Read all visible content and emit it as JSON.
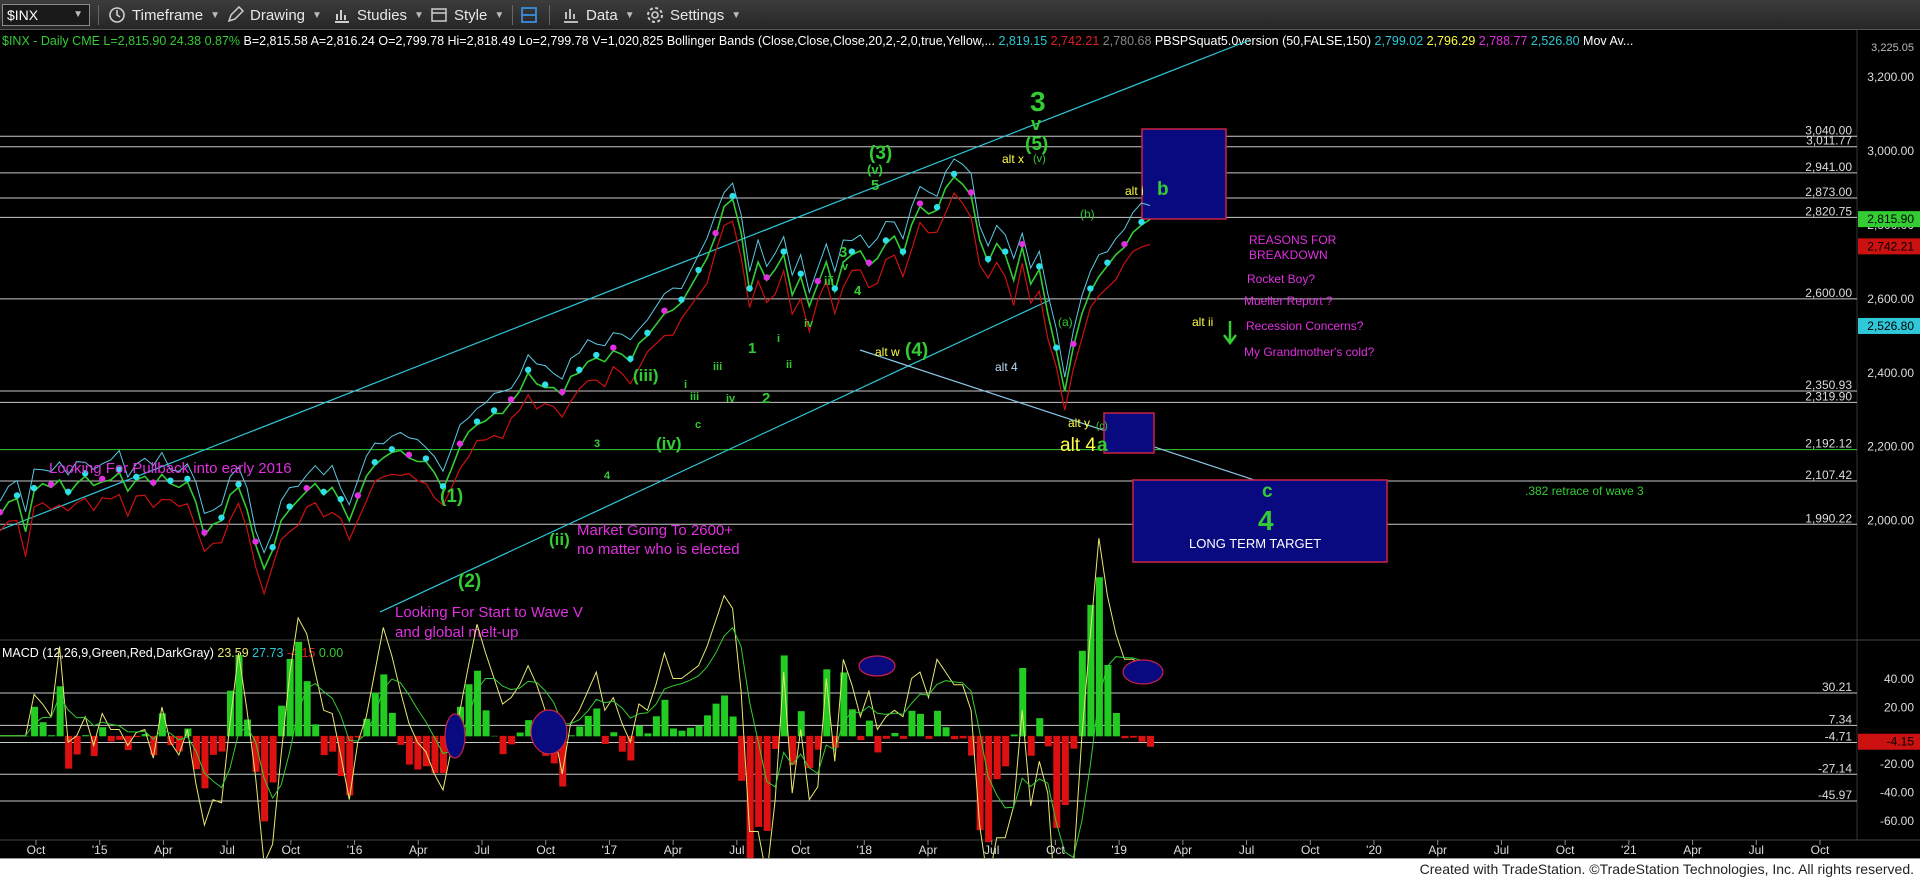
{
  "toolbar": {
    "symbol": "$INX",
    "timeframe": "Timeframe",
    "drawing": "Drawing",
    "studies": "Studies",
    "style": "Style",
    "data": "Data",
    "settings": "Settings"
  },
  "colors": {
    "bg": "#000000",
    "bright_green": "#33cc33",
    "magenta": "#e030e0",
    "yellow": "#ffff44",
    "cyan": "#2ec8d8",
    "light_blue": "#b8d8f0",
    "red": "#cc1111",
    "box_fill": "#0a0a80",
    "box_border": "#cc2244"
  },
  "header_line": [
    {
      "text": "$INX - Daily",
      "color": "#33cc33"
    },
    {
      "text": "CME",
      "color": "#33cc33"
    },
    {
      "text": "L=2,815.90",
      "color": "#33cc33"
    },
    {
      "text": "24.38",
      "color": "#33cc33"
    },
    {
      "text": "0.87%",
      "color": "#33cc33"
    },
    {
      "text": "B=2,815.58",
      "color": "#ffffff"
    },
    {
      "text": "A=2,816.24",
      "color": "#ffffff"
    },
    {
      "text": "O=2,799.78",
      "color": "#ffffff"
    },
    {
      "text": "Hi=2,818.49",
      "color": "#ffffff"
    },
    {
      "text": "Lo=2,799.78",
      "color": "#ffffff"
    },
    {
      "text": "V=1,020,825",
      "color": "#ffffff"
    },
    {
      "text": "Bollinger Bands (Close,Close,Close,20,2,-2,0,true,Yellow,...",
      "color": "#ffffff"
    },
    {
      "text": "2,819.15",
      "color": "#2ec8d8"
    },
    {
      "text": "2,742.21",
      "color": "#dd2222"
    },
    {
      "text": "2,780.68",
      "color": "#888888"
    },
    {
      "text": "PBSPSquat5.0version (50,FALSE,150)",
      "color": "#ffffff"
    },
    {
      "text": "2,799.02",
      "color": "#2ec8d8"
    },
    {
      "text": "2,796.29",
      "color": "#ffff44"
    },
    {
      "text": "2,788.77",
      "color": "#e030e0"
    },
    {
      "text": "2,526.80",
      "color": "#2ec8d8"
    },
    {
      "text": "Mov Av...",
      "color": "#ffffff"
    }
  ],
  "chart_data": [
    {
      "type": "line",
      "title": "$INX - Daily",
      "yscale": "linear",
      "ylim": [
        1880,
        3260
      ],
      "x_tick_labels": [
        "Oct",
        "'15",
        "Apr",
        "Jul",
        "Oct",
        "'16",
        "Apr",
        "Jul",
        "Oct",
        "'17",
        "Apr",
        "Jul",
        "Oct",
        "'18",
        "Apr",
        "Jul",
        "Oct",
        "'19",
        "Apr",
        "Jul",
        "Oct",
        "'20",
        "Apr",
        "Jul",
        "Oct",
        "'21",
        "Apr",
        "Jul",
        "Oct"
      ],
      "y_tick_labels": [
        2000,
        2200,
        2400,
        2600,
        2800,
        3000,
        3200
      ],
      "top_partial_label": "3,225.05",
      "horizontal_levels": [
        {
          "label": "3,040.00",
          "value": 3040
        },
        {
          "label": "3,011.77",
          "value": 3011.77
        },
        {
          "label": "2,941.00",
          "value": 2941
        },
        {
          "label": "2,873.00",
          "value": 2873
        },
        {
          "label": "2,820.75",
          "value": 2820.75
        },
        {
          "label": "2,600.00",
          "value": 2600
        },
        {
          "label": "2,350.93",
          "value": 2350.93
        },
        {
          "label": "2,319.90",
          "value": 2319.9
        },
        {
          "label": "2,192.12",
          "value": 2192.12,
          "color": "#33cc33"
        },
        {
          "label": "2,107.42",
          "value": 2107.42
        },
        {
          "label": "1,990.22",
          "value": 1990.22
        }
      ],
      "price_tags": [
        {
          "label": "2,815.90",
          "value": 2815.9,
          "color": "#33cc33"
        },
        {
          "label": "2,742.21",
          "value": 2742.21,
          "color": "#cc1111"
        },
        {
          "label": "2,526.80",
          "value": 2526.8,
          "color": "#2ec8d8"
        }
      ],
      "price_path": [
        [
          0,
          2015
        ],
        [
          1,
          2050
        ],
        [
          2,
          2060
        ],
        [
          3,
          1970
        ],
        [
          4,
          2080
        ],
        [
          5,
          2100
        ],
        [
          6,
          2090
        ],
        [
          7,
          2110
        ],
        [
          8,
          2070
        ],
        [
          9,
          2100
        ],
        [
          10,
          2120
        ],
        [
          11,
          2095
        ],
        [
          12,
          2105
        ],
        [
          13,
          2110
        ],
        [
          14,
          2130
        ],
        [
          15,
          2080
        ],
        [
          16,
          2110
        ],
        [
          17,
          2120
        ],
        [
          18,
          2095
        ],
        [
          19,
          2125
        ],
        [
          20,
          2100
        ],
        [
          21,
          2090
        ],
        [
          22,
          2105
        ],
        [
          23,
          2050
        ],
        [
          24,
          1960
        ],
        [
          25,
          1990
        ],
        [
          26,
          2000
        ],
        [
          27,
          2070
        ],
        [
          28,
          2090
        ],
        [
          29,
          2030
        ],
        [
          30,
          1935
        ],
        [
          31,
          1870
        ],
        [
          32,
          1920
        ],
        [
          33,
          2000
        ],
        [
          34,
          2030
        ],
        [
          35,
          2055
        ],
        [
          36,
          2080
        ],
        [
          37,
          2100
        ],
        [
          38,
          2070
        ],
        [
          39,
          2090
        ],
        [
          40,
          2050
        ],
        [
          41,
          2000
        ],
        [
          42,
          2060
        ],
        [
          43,
          2120
        ],
        [
          44,
          2150
        ],
        [
          45,
          2170
        ],
        [
          46,
          2185
        ],
        [
          47,
          2190
        ],
        [
          48,
          2170
        ],
        [
          49,
          2160
        ],
        [
          50,
          2160
        ],
        [
          51,
          2130
        ],
        [
          52,
          2085
        ],
        [
          53,
          2140
        ],
        [
          54,
          2200
        ],
        [
          55,
          2240
        ],
        [
          56,
          2260
        ],
        [
          57,
          2270
        ],
        [
          58,
          2290
        ],
        [
          59,
          2290
        ],
        [
          60,
          2320
        ],
        [
          61,
          2350
        ],
        [
          62,
          2400
        ],
        [
          63,
          2370
        ],
        [
          64,
          2360
        ],
        [
          65,
          2360
        ],
        [
          66,
          2340
        ],
        [
          67,
          2390
        ],
        [
          68,
          2400
        ],
        [
          69,
          2430
        ],
        [
          70,
          2440
        ],
        [
          71,
          2430
        ],
        [
          72,
          2460
        ],
        [
          73,
          2450
        ],
        [
          74,
          2430
        ],
        [
          75,
          2480
        ],
        [
          76,
          2500
        ],
        [
          77,
          2530
        ],
        [
          78,
          2560
        ],
        [
          79,
          2570
        ],
        [
          80,
          2590
        ],
        [
          81,
          2630
        ],
        [
          82,
          2670
        ],
        [
          83,
          2710
        ],
        [
          84,
          2770
        ],
        [
          85,
          2850
        ],
        [
          86,
          2870
        ],
        [
          87,
          2780
        ],
        [
          88,
          2620
        ],
        [
          89,
          2700
        ],
        [
          90,
          2650
        ],
        [
          91,
          2680
        ],
        [
          92,
          2720
        ],
        [
          93,
          2610
        ],
        [
          94,
          2660
        ],
        [
          95,
          2580
        ],
        [
          96,
          2640
        ],
        [
          97,
          2700
        ],
        [
          98,
          2620
        ],
        [
          99,
          2700
        ],
        [
          100,
          2720
        ],
        [
          101,
          2730
        ],
        [
          102,
          2690
        ],
        [
          103,
          2710
        ],
        [
          104,
          2750
        ],
        [
          105,
          2770
        ],
        [
          106,
          2720
        ],
        [
          107,
          2800
        ],
        [
          108,
          2850
        ],
        [
          109,
          2830
        ],
        [
          110,
          2840
        ],
        [
          111,
          2900
        ],
        [
          112,
          2930
        ],
        [
          113,
          2910
        ],
        [
          114,
          2880
        ],
        [
          115,
          2760
        ],
        [
          116,
          2700
        ],
        [
          117,
          2750
        ],
        [
          118,
          2720
        ],
        [
          119,
          2650
        ],
        [
          120,
          2740
        ],
        [
          121,
          2640
        ],
        [
          122,
          2680
        ],
        [
          123,
          2560
        ],
        [
          124,
          2460
        ],
        [
          125,
          2350
        ],
        [
          126,
          2470
        ],
        [
          127,
          2560
        ],
        [
          128,
          2620
        ],
        [
          129,
          2660
        ],
        [
          130,
          2690
        ],
        [
          131,
          2720
        ],
        [
          132,
          2740
        ],
        [
          133,
          2780
        ],
        [
          134,
          2800
        ],
        [
          135,
          2815
        ]
      ],
      "macd": {
        "title": "MACD (12,26,9,Green,Red,DarkGray)",
        "values": {
          "macd": 23.59,
          "signal": 27.73,
          "histogram": -4.15,
          "zero": 0.0
        },
        "ylim": [
          -70,
          50
        ],
        "y_tick_labels": [
          40.0,
          20.0,
          -20.0,
          -40.0,
          -60.0
        ],
        "levels": [
          {
            "label": "30.21",
            "value": 30.21
          },
          {
            "label": "7.34",
            "value": 7.34
          },
          {
            "label": "-4.71",
            "value": -4.71
          },
          {
            "label": "-27.14",
            "value": -27.14
          },
          {
            "label": "-45.97",
            "value": -45.97
          }
        ],
        "current_tag": {
          "label": "-4.15",
          "value": -4.15,
          "color": "#cc1111"
        }
      }
    }
  ],
  "annotations": {
    "wave_3_big": "3",
    "wave_v_big": "v",
    "wave_5_paren": "(5)",
    "wave_v_paren_top": "(v)",
    "alt_x": "alt x",
    "wave_3_paren": "(3)",
    "wave_v_paren_3": "(v)",
    "wave_5_small": "5",
    "alt_i": "alt i",
    "wave_b_big": "b",
    "wave_b_paren": "(b)",
    "wave_a_paren": "(a)",
    "wave_3_mid": "3",
    "wave_v_small": "v",
    "wave_iii_small": "iii",
    "wave_4_small": "4",
    "wave_iv_small": "iv",
    "wave_i_small": "i",
    "wave_1": "1",
    "wave_2": "2",
    "wave_iii_2": "iii",
    "wave_ii_2": "ii",
    "wave_iv_2": "iv",
    "alt_w": "alt w",
    "wave_4_paren": "(4)",
    "alt_4_small": "alt 4",
    "alt_ii": "alt ii",
    "alt_y": "alt y",
    "wave_c_paren": "(c)",
    "alt_4_big": "alt 4",
    "wave_a_big": "a",
    "wave_iii_paren": "(iii)",
    "wave_iv_paren": "(iv)",
    "wave_1_paren": "(1)",
    "wave_2_paren": "(2)",
    "wave_ii_paren": "(ii)",
    "wave_c": "c",
    "wave_4_big": "4",
    "pullback_note": "Looking For Pullback into early 2016",
    "market_note_1": "Market Going To 2600+",
    "market_note_2": "no matter who is elected",
    "start_v_note_1": "Looking For Start to Wave V",
    "start_v_note_2": "and global melt-up",
    "retrace_note": ".382 retrace of wave 3",
    "long_term_target": "LONG TERM TARGET",
    "reasons_1": "REASONS FOR",
    "reasons_2": "BREAKDOWN",
    "reason_rocket": "Rocket Boy?",
    "reason_mueller": "Mueller Report ?",
    "reason_recession": "Recession Concerns?",
    "reason_grandmother": "My Grandmother's cold?",
    "small_3": "3",
    "small_4": "4",
    "small_5": "5",
    "small_i": "i",
    "small_ii": "ii",
    "small_iii": "iii",
    "small_iv": "iv",
    "small_c": "c"
  },
  "footer": "Created with TradeStation. ©TradeStation Technologies, Inc. All rights reserved."
}
